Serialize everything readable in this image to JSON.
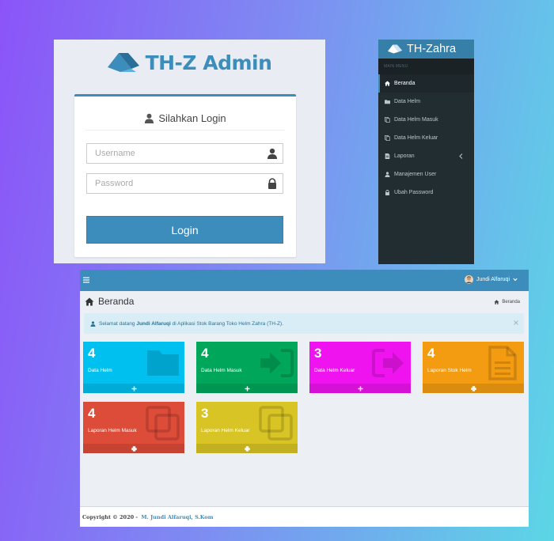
{
  "login": {
    "brand": "TH-Z Admin",
    "title": "Silahkan Login",
    "username_placeholder": "Username",
    "password_placeholder": "Password",
    "button_label": "Login"
  },
  "sidebar": {
    "brand": "TH-Zahra",
    "header": "MAIN MENU",
    "items": [
      {
        "label": "Beranda",
        "icon": "home-icon",
        "active": true
      },
      {
        "label": "Data Helm",
        "icon": "folder-icon"
      },
      {
        "label": "Data Helm Masuk",
        "icon": "copy-icon"
      },
      {
        "label": "Data Helm Keluar",
        "icon": "copy-icon"
      },
      {
        "label": "Laporan",
        "icon": "file-icon",
        "has_children": true
      },
      {
        "label": "Manajemen User",
        "icon": "user-icon"
      },
      {
        "label": "Ubah Password",
        "icon": "lock-icon"
      }
    ]
  },
  "dashboard": {
    "user_name": "Jundi Alfaruqi",
    "page_title": "Beranda",
    "breadcrumb": "Beranda",
    "alert": {
      "prefix": "Selamat datang ",
      "name": "Jundi Alfaruqi",
      "suffix": " di Aplikasi Stok Barang Toko Helm Zahra (TH-Z)."
    },
    "boxes": [
      {
        "count": "4",
        "label": "Data Helm",
        "color": "#00c0ef",
        "icon": "folder-icon",
        "footer_icon": "plus-icon"
      },
      {
        "count": "4",
        "label": "Data Helm Masuk",
        "color": "#00a65a",
        "icon": "sign-in-icon",
        "footer_icon": "plus-icon"
      },
      {
        "count": "3",
        "label": "Data Helm Keluar",
        "color": "#ef14ef",
        "icon": "sign-out-icon",
        "footer_icon": "plus-icon"
      },
      {
        "count": "4",
        "label": "Laporan Stok Helm",
        "color": "#f39c12",
        "icon": "file-text-icon",
        "footer_icon": "print-icon"
      },
      {
        "count": "4",
        "label": "Laporan Helm Masuk",
        "color": "#dd4b39",
        "icon": "copy-icon",
        "footer_icon": "print-icon"
      },
      {
        "count": "3",
        "label": "Laporan Helm Keluar",
        "color": "#d8c424",
        "icon": "copy-icon",
        "footer_icon": "print-icon"
      }
    ],
    "footer": {
      "copyright": "Copyright © 2020 - ",
      "author": "M. Jundi Alfaruqi, S.Kom"
    }
  }
}
